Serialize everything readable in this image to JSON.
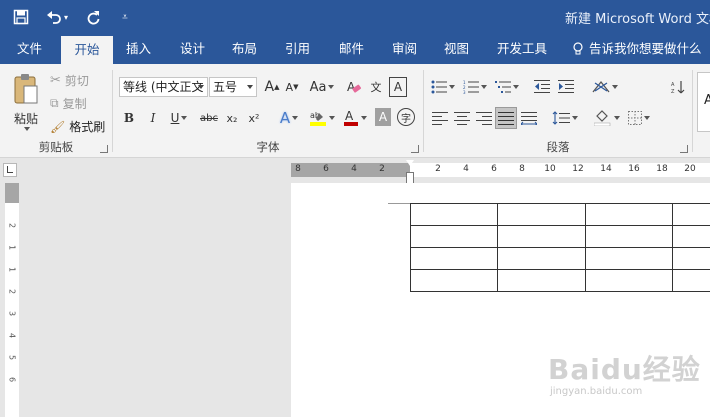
{
  "window": {
    "title": "新建 Microsoft Word 文档"
  },
  "tabs": [
    {
      "label": "文件"
    },
    {
      "label": "开始"
    },
    {
      "label": "插入"
    },
    {
      "label": "设计"
    },
    {
      "label": "布局"
    },
    {
      "label": "引用"
    },
    {
      "label": "邮件"
    },
    {
      "label": "审阅"
    },
    {
      "label": "视图"
    },
    {
      "label": "开发工具"
    }
  ],
  "tell_me": "告诉我你想要做什么",
  "clipboard": {
    "group_label": "剪贴板",
    "paste": "粘贴",
    "cut": "剪切",
    "copy": "复制",
    "format_painter": "格式刷"
  },
  "font": {
    "group_label": "字体",
    "font_name": "等线 (中文正文",
    "font_size": "五号",
    "change_case": "Aa",
    "bold": "B",
    "italic": "I",
    "underline": "U",
    "strikethrough": "abc",
    "subscript": "x₂",
    "superscript": "x²",
    "text_effects": "A",
    "highlight_color": "#ffff00",
    "font_color": "#c00000",
    "char_shading": "A",
    "enclose_char": "字",
    "grow": "A",
    "shrink": "A",
    "clear_format": "A",
    "phonetic": "文",
    "border_char": "A"
  },
  "paragraph": {
    "group_label": "段落"
  },
  "styles": {
    "preview": "A"
  },
  "ruler": {
    "horizontal_left": [
      "8",
      "6",
      "4",
      "2"
    ],
    "horizontal_right": [
      "2",
      "4",
      "6",
      "8",
      "10",
      "12",
      "14",
      "16",
      "18",
      "20"
    ],
    "vertical": [
      "2",
      "1",
      "1",
      "2",
      "3",
      "4",
      "5",
      "6"
    ]
  },
  "document": {
    "table_rows": 4,
    "table_cols": 4
  },
  "watermark": {
    "main": "Baidu经验",
    "sub": "jingyan.baidu.com"
  },
  "colors": {
    "title_bar": "#2b579a",
    "ribbon": "#f3f3f3",
    "workspace": "#e6e6e6"
  }
}
